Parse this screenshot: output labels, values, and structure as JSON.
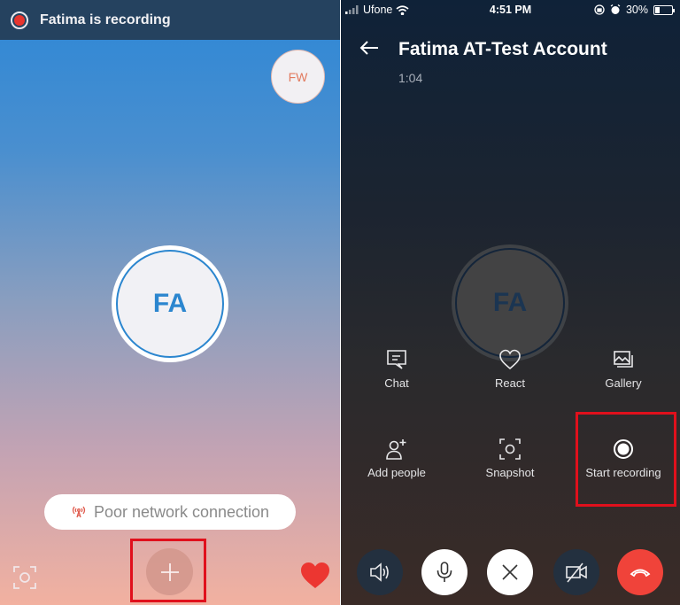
{
  "left_screen": {
    "recording_banner": {
      "text": "Fatima is recording",
      "icon": "recording-dot-icon"
    },
    "self_view_avatar": {
      "initials": "FW"
    },
    "remote_avatar": {
      "initials": "FA"
    },
    "network_warning": {
      "text": "Poor network connection",
      "icon": "antenna-signal-icon"
    },
    "bottom_bar": {
      "snapshot": {
        "icon": "snapshot-icon"
      },
      "more": {
        "icon": "plus-icon",
        "highlighted": true
      },
      "react": {
        "icon": "heart-icon"
      }
    }
  },
  "right_screen": {
    "status_bar": {
      "carrier": "Ufone",
      "time": "4:51 PM",
      "battery": "30%",
      "battery_level": 0.3
    },
    "header": {
      "back_icon": "back-arrow-icon",
      "title": "Fatima AT-Test Account",
      "duration": "1:04"
    },
    "remote_avatar": {
      "initials": "FA"
    },
    "menu": [
      {
        "label": "Chat",
        "icon": "chat-icon"
      },
      {
        "label": "React",
        "icon": "heart-outline-icon"
      },
      {
        "label": "Gallery",
        "icon": "gallery-icon"
      },
      {
        "label": "Add people",
        "icon": "add-person-icon"
      },
      {
        "label": "Snapshot",
        "icon": "snapshot-icon"
      },
      {
        "label": "Start recording",
        "icon": "record-icon",
        "highlighted": true
      }
    ],
    "controls": [
      {
        "name": "speaker",
        "icon": "speaker-icon"
      },
      {
        "name": "microphone",
        "icon": "microphone-icon"
      },
      {
        "name": "close-menu",
        "icon": "close-icon"
      },
      {
        "name": "video-off",
        "icon": "video-off-icon"
      },
      {
        "name": "end-call",
        "icon": "end-call-icon"
      }
    ]
  },
  "colors": {
    "recording_red": "#e8352e",
    "highlight_red": "#e0101c",
    "avatar_blue": "#2b86cf",
    "end_call_red": "#f0433a"
  }
}
